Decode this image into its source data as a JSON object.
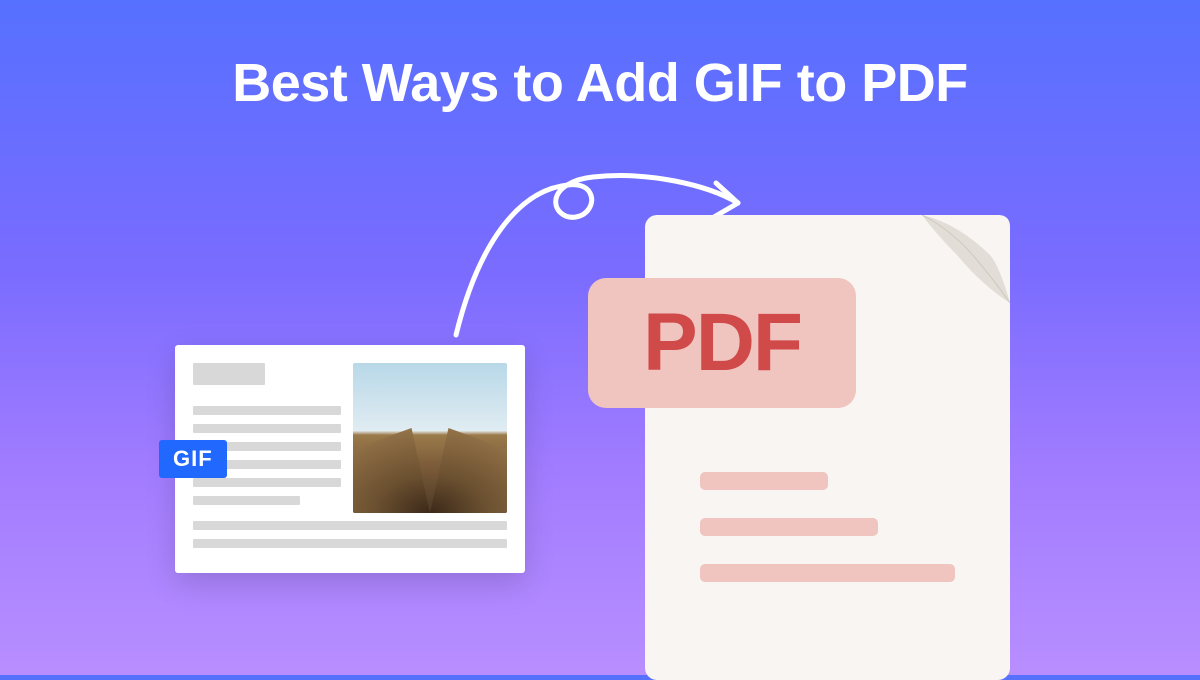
{
  "title": "Best Ways to Add GIF to PDF",
  "gif_badge": "GIF",
  "pdf_badge": "PDF",
  "colors": {
    "background_gradient_start": "#5670ff",
    "background_gradient_end": "#b88eff",
    "title_color": "#ffffff",
    "gif_badge_bg": "#2168ff",
    "pdf_badge_bg": "#f0c4bf",
    "pdf_text": "#d04a4a",
    "pdf_doc_bg": "#f8f5f2"
  }
}
